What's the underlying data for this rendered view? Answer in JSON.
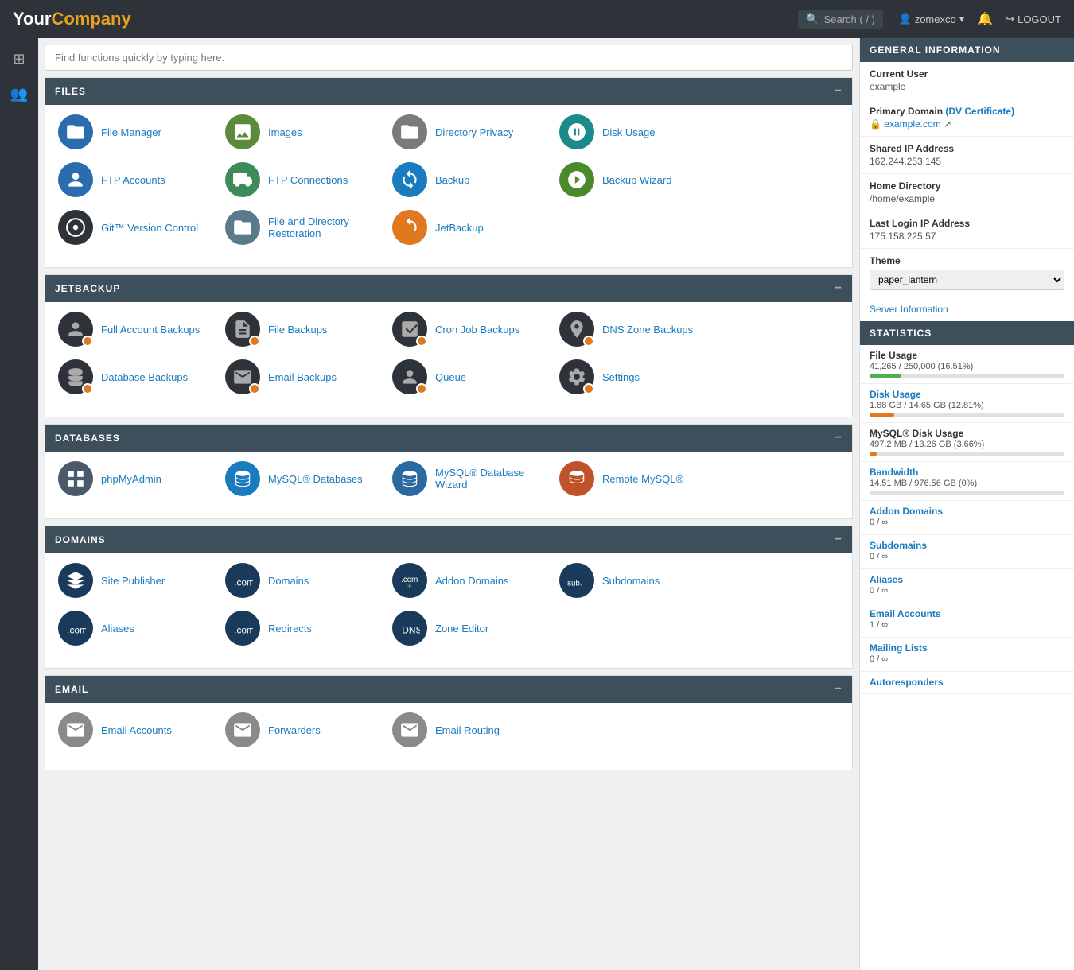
{
  "topnav": {
    "logo_your": "Your",
    "logo_company": "Company",
    "search_label": "Search ( / )",
    "user": "zomexco",
    "logout_label": "LOGOUT"
  },
  "global_search": {
    "placeholder": "Find functions quickly by typing here."
  },
  "sections": [
    {
      "id": "files",
      "header": "FILES",
      "items": [
        {
          "label": "File Manager",
          "icon_type": "blue"
        },
        {
          "label": "Images",
          "icon_type": "green"
        },
        {
          "label": "Directory Privacy",
          "icon_type": "gray-dark"
        },
        {
          "label": "Disk Usage",
          "icon_type": "teal"
        },
        {
          "label": "FTP Accounts",
          "icon_type": "blue"
        },
        {
          "label": "FTP Connections",
          "icon_type": "teal"
        },
        {
          "label": "Backup",
          "icon_type": "blue"
        },
        {
          "label": "Backup Wizard",
          "icon_type": "green"
        },
        {
          "label": "Git™ Version Control",
          "icon_type": "dark"
        },
        {
          "label": "File and Directory Restoration",
          "icon_type": "gray-dark"
        },
        {
          "label": "JetBackup",
          "icon_type": "orange"
        }
      ]
    },
    {
      "id": "jetbackup",
      "header": "JETBACKUP",
      "items": [
        {
          "label": "Full Account Backups",
          "icon_type": "dark"
        },
        {
          "label": "File Backups",
          "icon_type": "dark"
        },
        {
          "label": "Cron Job Backups",
          "icon_type": "dark"
        },
        {
          "label": "DNS Zone Backups",
          "icon_type": "dark"
        },
        {
          "label": "Database Backups",
          "icon_type": "dark"
        },
        {
          "label": "Email Backups",
          "icon_type": "dark"
        },
        {
          "label": "Queue",
          "icon_type": "dark"
        },
        {
          "label": "Settings",
          "icon_type": "dark"
        }
      ]
    },
    {
      "id": "databases",
      "header": "DATABASES",
      "items": [
        {
          "label": "phpMyAdmin",
          "icon_type": "gray-dark"
        },
        {
          "label": "MySQL® Databases",
          "icon_type": "blue"
        },
        {
          "label": "MySQL® Database Wizard",
          "icon_type": "blue"
        },
        {
          "label": "Remote MySQL®",
          "icon_type": "orange"
        }
      ]
    },
    {
      "id": "domains",
      "header": "DOMAINS",
      "items": [
        {
          "label": "Site Publisher",
          "icon_type": "navy"
        },
        {
          "label": "Domains",
          "icon_type": "navy"
        },
        {
          "label": "Addon Domains",
          "icon_type": "navy"
        },
        {
          "label": "Subdomains",
          "icon_type": "navy"
        },
        {
          "label": "Aliases",
          "icon_type": "navy"
        },
        {
          "label": "Redirects",
          "icon_type": "navy"
        },
        {
          "label": "Zone Editor",
          "icon_type": "navy"
        }
      ]
    },
    {
      "id": "email",
      "header": "EMAIL",
      "items": [
        {
          "label": "Email Accounts",
          "icon_type": "gray-dark"
        },
        {
          "label": "Forwarders",
          "icon_type": "gray-dark"
        },
        {
          "label": "Email Routing",
          "icon_type": "gray-dark"
        }
      ]
    }
  ],
  "general_info": {
    "header": "GENERAL INFORMATION",
    "current_user_label": "Current User",
    "current_user_value": "example",
    "primary_domain_label": "Primary Domain",
    "dv_cert_label": "DV Certificate",
    "domain_value": "example.com",
    "shared_ip_label": "Shared IP Address",
    "shared_ip_value": "162.244.253.145",
    "home_dir_label": "Home Directory",
    "home_dir_value": "/home/example",
    "last_login_label": "Last Login IP Address",
    "last_login_value": "175.158.225.57",
    "theme_label": "Theme",
    "theme_value": "paper_lantern",
    "server_info_label": "Server Information"
  },
  "statistics": {
    "header": "STATISTICS",
    "file_usage_label": "File Usage",
    "file_usage_value": "41,265 / 250,000   (16.51%)",
    "file_usage_pct": 16.51,
    "disk_usage_label": "Disk Usage",
    "disk_usage_value": "1.88 GB / 14.65 GB  (12.81%)",
    "disk_usage_pct": 12.81,
    "mysql_disk_label": "MySQL® Disk Usage",
    "mysql_disk_value": "497.2 MB / 13.26 GB  (3.66%)",
    "mysql_disk_pct": 3.66,
    "bandwidth_label": "Bandwidth",
    "bandwidth_value": "14.51 MB / 976.56 GB  (0%)",
    "bandwidth_pct": 0.01,
    "addon_domains_label": "Addon Domains",
    "addon_domains_value": "0 / ∞",
    "subdomains_label": "Subdomains",
    "subdomains_value": "0 / ∞",
    "aliases_label": "Aliases",
    "aliases_value": "0 / ∞",
    "email_accounts_label": "Email Accounts",
    "email_accounts_value": "1 / ∞",
    "mailing_lists_label": "Mailing Lists",
    "mailing_lists_value": "0 / ∞",
    "autoresponders_label": "Autoresponders"
  },
  "icons": {
    "file_manager": "📁",
    "images": "🖼",
    "dir_privacy": "📂",
    "disk_usage": "💿",
    "ftp": "👤",
    "ftp_conn": "🚛",
    "backup": "🔄",
    "backup_wizard": "⚙",
    "git": "🔀",
    "restore": "📂",
    "jetbackup": "🔄",
    "full_backup": "👤",
    "file_backup": "📋",
    "cron": "📦",
    "dns_backup": "📍",
    "db_backup": "🗄",
    "email_backup": "📧",
    "queue": "👤",
    "settings": "⚙",
    "phpmyadmin": "⬛",
    "mysql": "🗄",
    "mysql_wizard": "🗄",
    "remote_mysql": "🗄",
    "site_publisher": "🚀",
    "domains": "🌐",
    "addon_domains": "🌐",
    "subdomains": "🔤",
    "aliases": "🌐",
    "redirects": "🌐",
    "zone_editor": "📋",
    "email_accounts": "📧",
    "forwarders": "📤",
    "email_routing": "✉"
  }
}
